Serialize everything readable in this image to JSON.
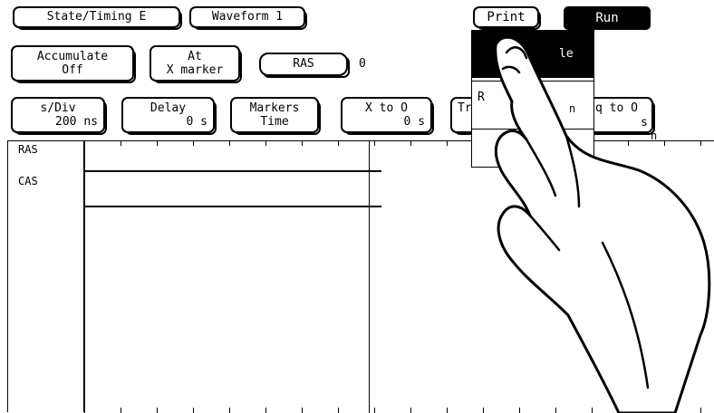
{
  "top_bar": {
    "mode_button": "State/Timing E",
    "waveform_button": "Waveform 1",
    "print_button": "Print",
    "run_button": "Run"
  },
  "row2": {
    "accumulate": {
      "line1": "Accumulate",
      "line2": "Off"
    },
    "at_marker": {
      "line1": "At",
      "line2": "X marker"
    },
    "signal_field": "RAS",
    "signal_value": "0"
  },
  "row3": {
    "sdiv": {
      "line1": "s/Div",
      "line2": "200 ns"
    },
    "delay": {
      "line1": "Delay",
      "line2": "0  s"
    },
    "markers": {
      "line1": "Markers",
      "line2": "Time"
    },
    "x_to_o": {
      "line1": "X to O",
      "line2": "0  s"
    },
    "trig_partial": "Tr",
    "trig_to_o_partial": "q to O",
    "trig_to_o_value": "s"
  },
  "print_menu": {
    "item1": "le",
    "item2": "R",
    "item2_tail": "n",
    "item3_tail": "n"
  },
  "waveform": {
    "channels": [
      "RAS",
      "CAS"
    ]
  },
  "colors": {
    "background": "#ffffff",
    "foreground": "#000000",
    "highlight": "#000000"
  }
}
